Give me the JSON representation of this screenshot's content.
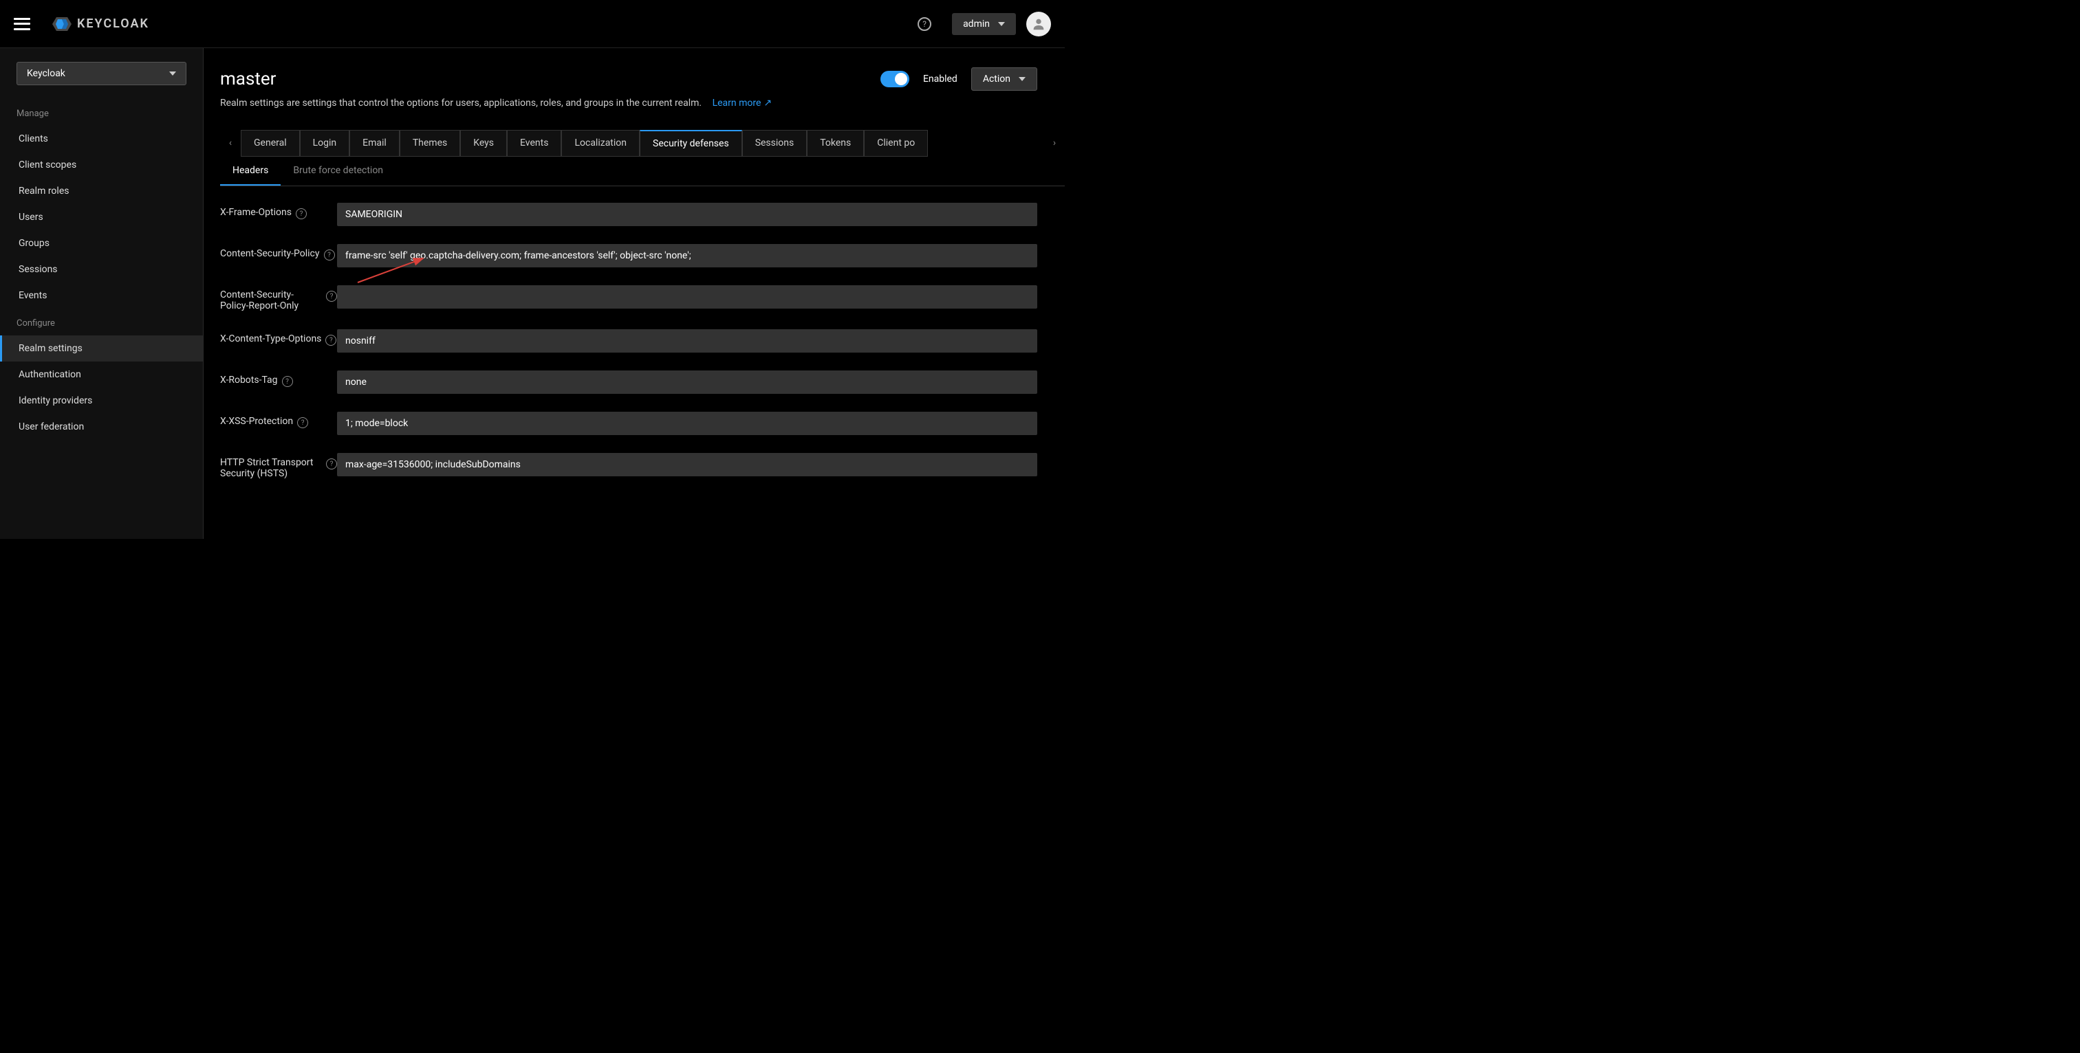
{
  "topbar": {
    "brand": "KEYCLOAK",
    "user": "admin"
  },
  "sidebar": {
    "realm_selector": "Keycloak",
    "sections": {
      "manage": {
        "label": "Manage",
        "items": [
          "Clients",
          "Client scopes",
          "Realm roles",
          "Users",
          "Groups",
          "Sessions",
          "Events"
        ]
      },
      "configure": {
        "label": "Configure",
        "items": [
          "Realm settings",
          "Authentication",
          "Identity providers",
          "User federation"
        ]
      }
    },
    "active_item": "Realm settings"
  },
  "page": {
    "title": "master",
    "enabled_label": "Enabled",
    "action_label": "Action",
    "description": "Realm settings are settings that control the options for users, applications, roles, and groups in the current realm.",
    "learn_more": "Learn more"
  },
  "tabs": {
    "items": [
      "General",
      "Login",
      "Email",
      "Themes",
      "Keys",
      "Events",
      "Localization",
      "Security defenses",
      "Sessions",
      "Tokens",
      "Client po"
    ],
    "active": "Security defenses"
  },
  "subtabs": {
    "items": [
      "Headers",
      "Brute force detection"
    ],
    "active": "Headers"
  },
  "form": {
    "fields": [
      {
        "label": "X-Frame-Options",
        "value": "SAMEORIGIN"
      },
      {
        "label": "Content-Security-Policy",
        "value": "frame-src 'self' geo.captcha-delivery.com; frame-ancestors 'self'; object-src 'none';"
      },
      {
        "label": "Content-Security-Policy-Report-Only",
        "value": ""
      },
      {
        "label": "X-Content-Type-Options",
        "value": "nosniff"
      },
      {
        "label": "X-Robots-Tag",
        "value": "none"
      },
      {
        "label": "X-XSS-Protection",
        "value": "1; mode=block"
      },
      {
        "label": "HTTP Strict Transport Security (HSTS)",
        "value": "max-age=31536000; includeSubDomains"
      }
    ]
  }
}
